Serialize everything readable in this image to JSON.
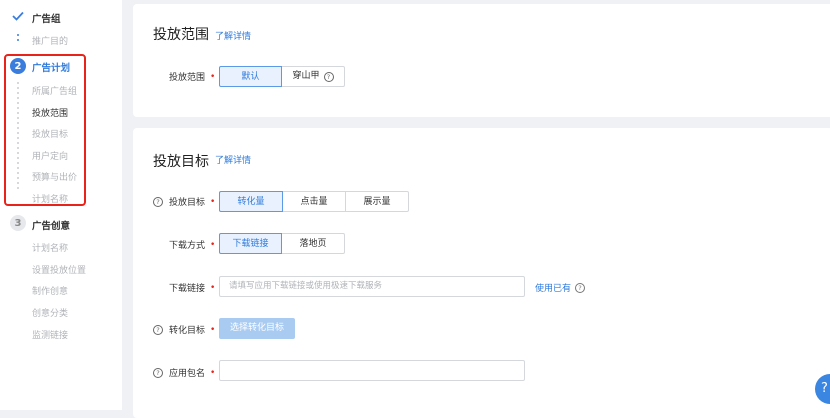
{
  "sidebar": {
    "step1": {
      "title": "广告组",
      "items": [
        "推广目的"
      ]
    },
    "step2": {
      "number": "2",
      "title": "广告计划",
      "items": [
        "所属广告组",
        "投放范围",
        "投放目标",
        "用户定向",
        "预算与出价",
        "计划名称"
      ]
    },
    "step3": {
      "number": "3",
      "title": "广告创意",
      "items": [
        "计划名称",
        "设置投放位置",
        "制作创意",
        "创意分类",
        "监测链接"
      ]
    },
    "active_item": "投放范围"
  },
  "section_range": {
    "title": "投放范围",
    "learn_more": "了解详情",
    "field_label": "投放范围",
    "options": [
      "默认",
      "穿山甲"
    ],
    "selected": "默认"
  },
  "section_target": {
    "title": "投放目标",
    "learn_more": "了解详情",
    "goal": {
      "label": "投放目标",
      "options": [
        "转化量",
        "点击量",
        "展示量"
      ],
      "selected": "转化量"
    },
    "download_method": {
      "label": "下载方式",
      "options": [
        "下载链接",
        "落地页"
      ],
      "selected": "下载链接"
    },
    "download_link": {
      "label": "下载链接",
      "placeholder": "请填写应用下载链接或使用极速下载服务",
      "use_existing": "使用已有"
    },
    "conversion_goal": {
      "label": "转化目标",
      "button": "选择转化目标"
    },
    "app_package": {
      "label": "应用包名",
      "value": ""
    }
  },
  "colors": {
    "accent": "#2f7bdc",
    "highlight": "#e8231a",
    "required": "#e8231a"
  }
}
